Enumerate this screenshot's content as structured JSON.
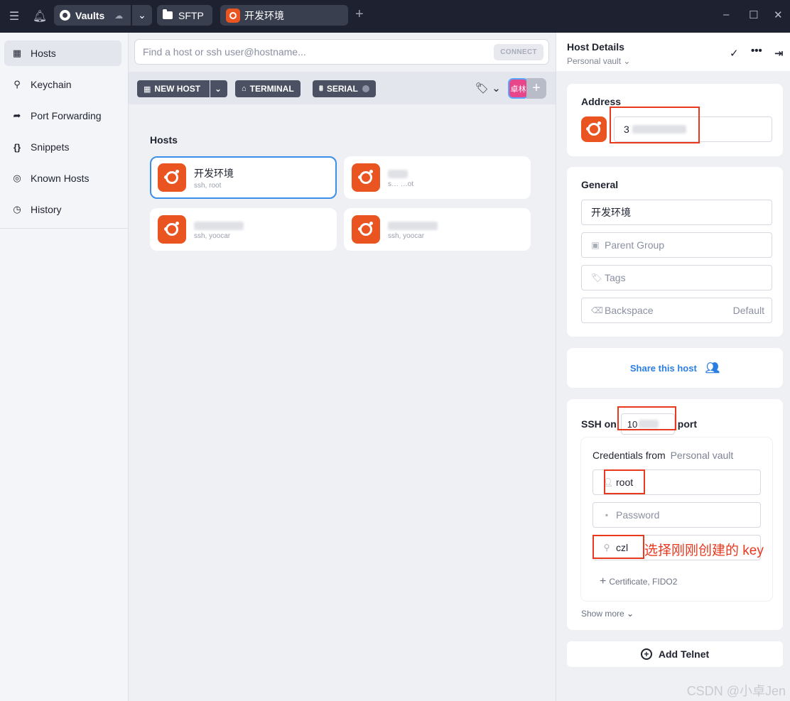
{
  "titlebar": {
    "vaults_label": "Vaults",
    "sftp_label": "SFTP",
    "active_tab_label": "开发环境",
    "new_tab_symbol": "+",
    "minimize": "–",
    "maximize": "☐",
    "close": "✕"
  },
  "sidebar": {
    "items": [
      {
        "label": "Hosts",
        "icon": "hosts-icon",
        "glyph": "▦"
      },
      {
        "label": "Keychain",
        "icon": "key-icon",
        "glyph": "⚲"
      },
      {
        "label": "Port Forwarding",
        "icon": "forward-icon",
        "glyph": "➦"
      },
      {
        "label": "Snippets",
        "icon": "braces-icon",
        "glyph": "{}"
      },
      {
        "label": "Known Hosts",
        "icon": "fingerprint-icon",
        "glyph": "◎"
      },
      {
        "label": "History",
        "icon": "clock-icon",
        "glyph": "◷"
      }
    ]
  },
  "main": {
    "search_placeholder": "Find a host or ssh user@hostname...",
    "connect_label": "CONNECT",
    "new_host_label": "NEW HOST",
    "terminal_label": "TERMINAL",
    "serial_label": "SERIAL",
    "avatar_label": "卓林",
    "section_title": "Hosts",
    "hosts": [
      {
        "name": "开发环境",
        "sub": "ssh, root"
      },
      {
        "name": "",
        "sub": "s… …ot"
      },
      {
        "name": "",
        "sub": "ssh, yoocar"
      },
      {
        "name": "",
        "sub": "ssh, yoocar"
      }
    ]
  },
  "panel": {
    "title": "Host Details",
    "vault": "Personal vault",
    "address_title": "Address",
    "address_value": "3",
    "general_title": "General",
    "label_value": "开发环境",
    "parent_group": "Parent Group",
    "tags": "Tags",
    "backspace": "Backspace",
    "backspace_default": "Default",
    "share_label": "Share this host",
    "ssh_prefix": "SSH on",
    "ssh_port_value": "10",
    "ssh_suffix": "port",
    "credentials_from": "Credentials from",
    "credentials_vault": "Personal vault",
    "username": "root",
    "password_placeholder": "Password",
    "key_value": "czl",
    "annotation": "选择刚刚创建的 key",
    "certificate": "Certificate, FIDO2",
    "show_more": "Show more",
    "add_telnet": "Add Telnet"
  },
  "watermark": "CSDN @小卓Jen",
  "colors": {
    "titlebar_bg": "#1e2230",
    "ubuntu_orange": "#e95420",
    "accent_blue": "#3b8fe8",
    "annotation_red": "#e8391f"
  }
}
